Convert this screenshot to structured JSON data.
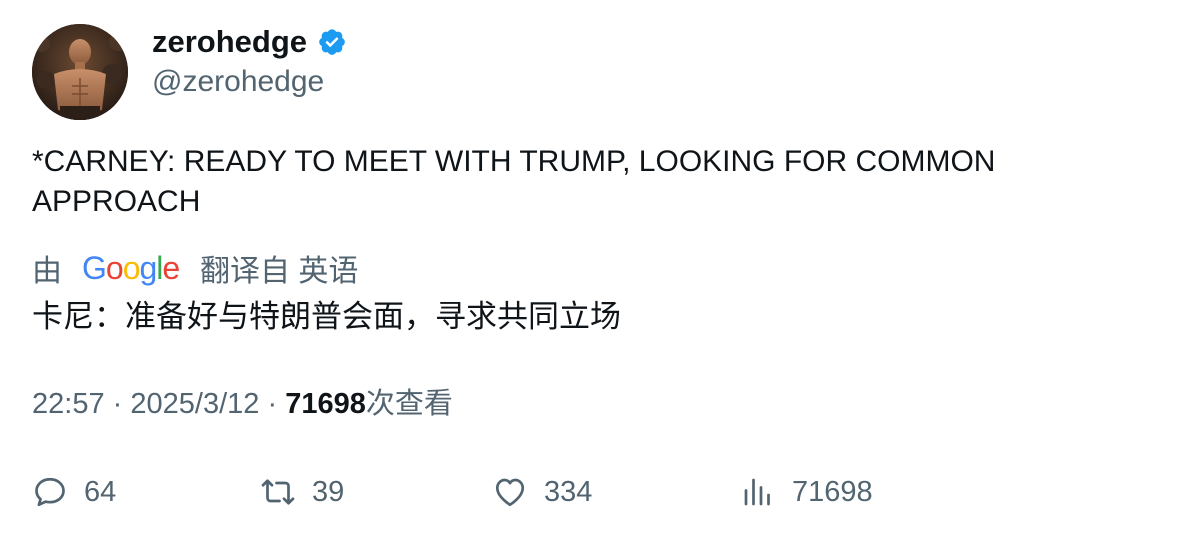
{
  "author": {
    "display_name": "zerohedge",
    "handle": "@zerohedge",
    "verified": true
  },
  "tweet": {
    "text": "*CARNEY: READY TO MEET WITH TRUMP, LOOKING FOR COMMON APPROACH"
  },
  "translation": {
    "by_label": "由",
    "provider": "Google",
    "from_label": "翻译自 英语",
    "text": "卡尼：准备好与特朗普会面，寻求共同立场"
  },
  "meta": {
    "time": "22:57",
    "separator": "·",
    "date": "2025/3/12",
    "views_count": "71698",
    "views_label": "次查看"
  },
  "actions": {
    "replies": "64",
    "retweets": "39",
    "likes": "334",
    "views": "71698"
  },
  "colors": {
    "text_primary": "#0f1419",
    "text_secondary": "#536471",
    "verified_blue": "#1d9bf0"
  }
}
